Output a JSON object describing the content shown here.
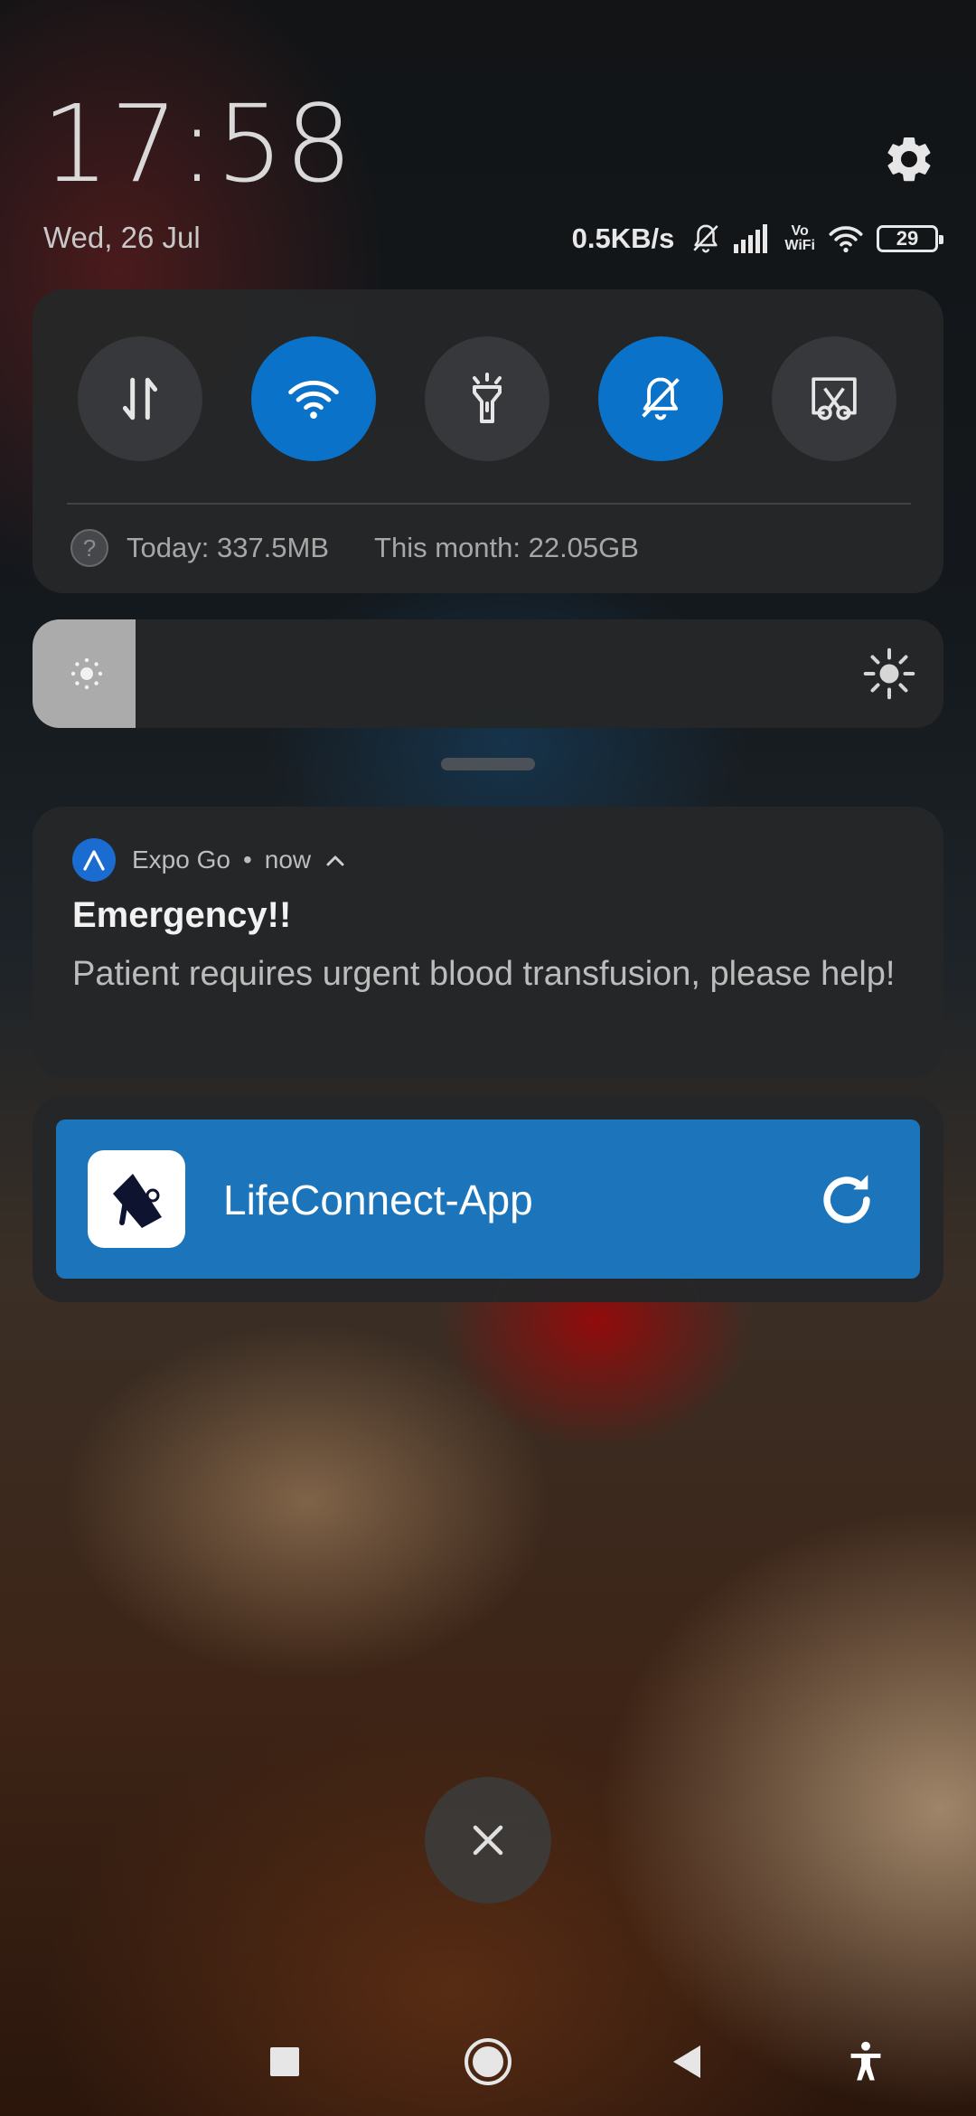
{
  "header": {
    "time": "17:58",
    "date": "Wed, 26 Jul",
    "network_speed": "0.5KB/s",
    "vowifi_label_top": "Vo",
    "vowifi_label_bottom": "WiFi",
    "battery_level": "29"
  },
  "quick_settings": {
    "toggles": [
      {
        "name": "mobile-data",
        "icon": "data-arrows-icon",
        "active": false
      },
      {
        "name": "wifi",
        "icon": "wifi-icon",
        "active": true
      },
      {
        "name": "flashlight",
        "icon": "flashlight-icon",
        "active": false
      },
      {
        "name": "silent",
        "icon": "bell-off-icon",
        "active": true
      },
      {
        "name": "screenshot",
        "icon": "screenshot-scissors-icon",
        "active": false
      }
    ],
    "usage_today": "Today: 337.5MB",
    "usage_month": "This month: 22.05GB",
    "help_glyph": "?"
  },
  "brightness": {
    "level": 0.113
  },
  "notification": {
    "app_name": "Expo Go",
    "separator": "•",
    "time": "now",
    "title": "Emergency!!",
    "body": "Patient requires urgent blood transfusion, please help!"
  },
  "app_card": {
    "app_name": "LifeConnect-App",
    "accent_color": "#1c75ba"
  },
  "dismiss": {
    "glyph": "✕"
  },
  "navigation": {
    "buttons": [
      "recents",
      "home",
      "back",
      "accessibility"
    ]
  }
}
